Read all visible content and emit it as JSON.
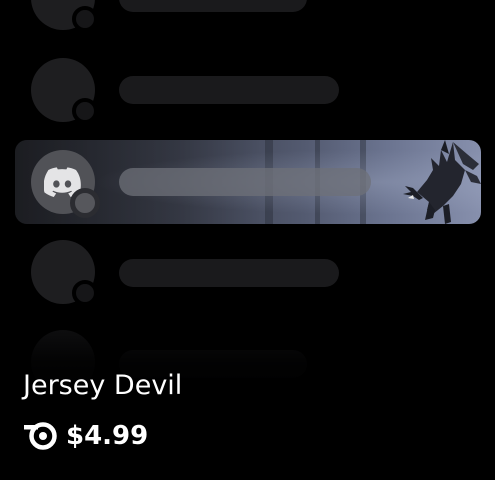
{
  "product": {
    "name": "Jersey Devil",
    "price": "$4.99",
    "currency_icon": "orbs-icon"
  },
  "preview": {
    "highlighted_avatar_icon": "discord-icon",
    "background_art": "jersey-devil-creature",
    "colors": {
      "card_background": "#000000",
      "placeholder": "#1e1e20",
      "highlight_start": "#2a2c33",
      "highlight_end": "#8790ad",
      "text": "#ffffff"
    }
  }
}
